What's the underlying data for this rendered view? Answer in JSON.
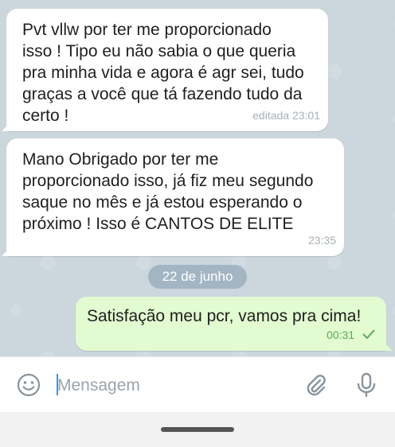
{
  "messages": [
    {
      "direction": "incoming",
      "text": "Pvt vllw por ter me proporcionado\nisso ! Tipo eu não sabia o que queria\npra minha vida e agora é agr sei, tudo\ngraças a você que tá fazendo tudo da\ncerto !",
      "meta": "editada 23:01"
    },
    {
      "direction": "incoming",
      "text": "Mano Obrigado por ter me\nproporcionado isso, já fiz meu segundo\nsaque no mês e já estou esperando o\npróximo ! Isso é CANTOS DE ELITE",
      "meta": "23:35"
    },
    {
      "direction": "outgoing",
      "text": "Satisfação meu pcr, vamos pra cima!",
      "meta": "00:31",
      "status_icon": "single-check-icon"
    }
  ],
  "date_separator": "22 de junho",
  "composer": {
    "placeholder": "Mensagem",
    "value": ""
  },
  "icons": {
    "emoji": "emoji-icon",
    "attach": "paperclip-icon",
    "mic": "microphone-icon"
  },
  "colors": {
    "incoming_bubble": "#ffffff",
    "outgoing_bubble": "#e2fbd0",
    "timestamp_outgoing": "#5fa85a",
    "chat_background": "#cbd6dd"
  }
}
